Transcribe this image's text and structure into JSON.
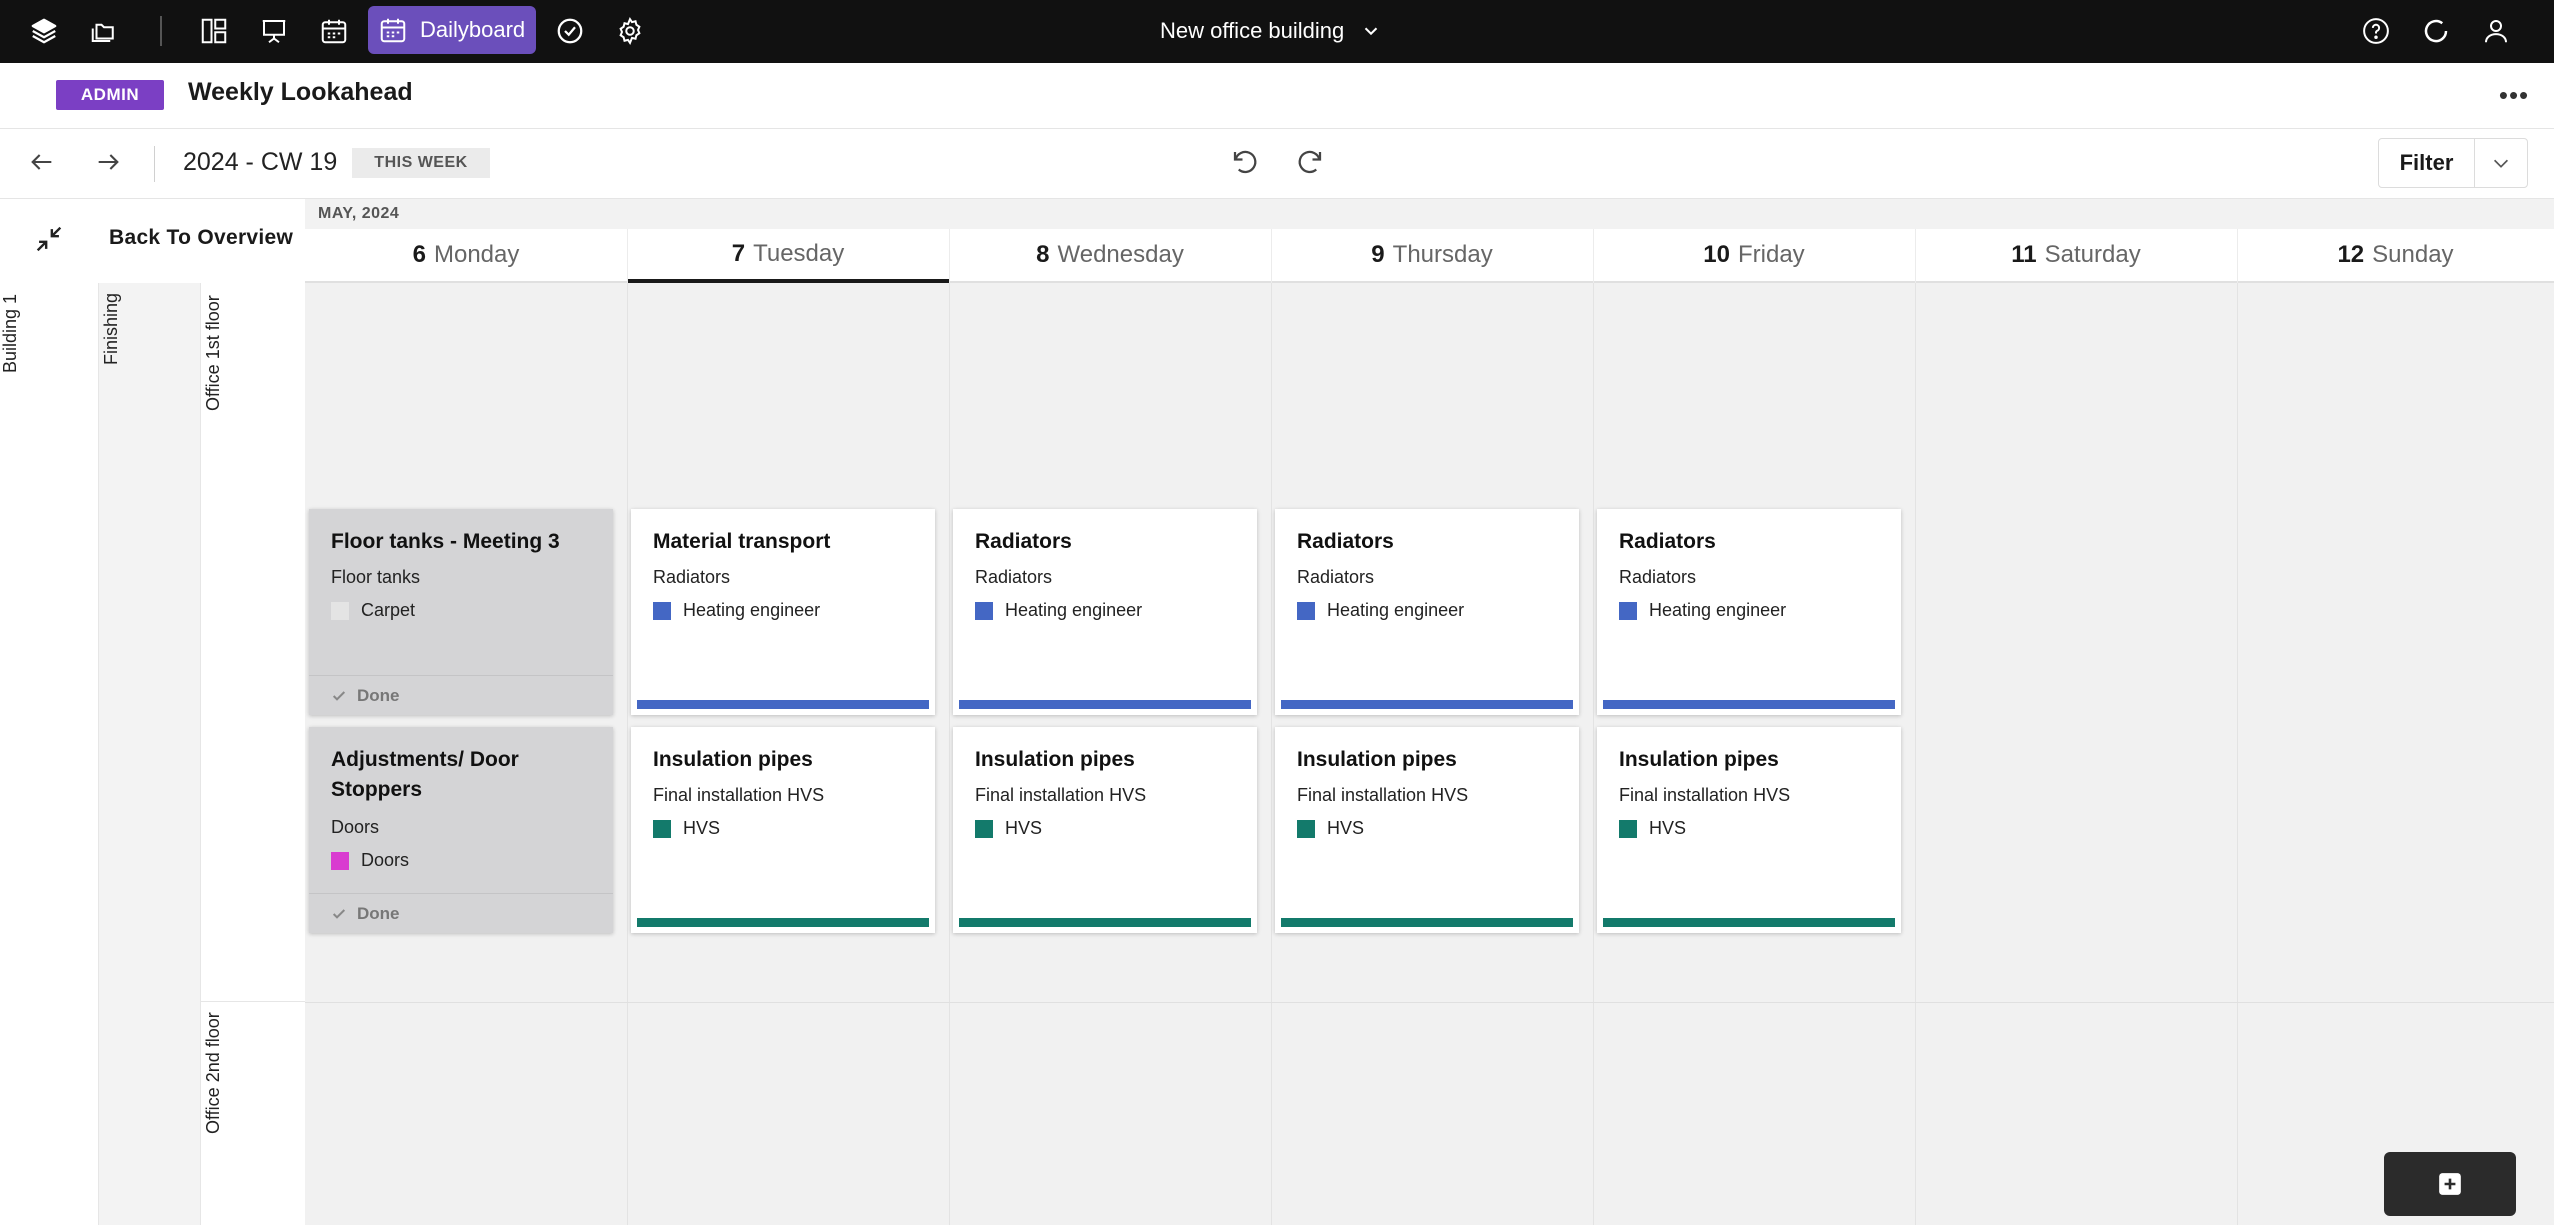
{
  "topbar": {
    "active_label": "Dailyboard",
    "project_name": "New office building",
    "icons": [
      "layers-icon",
      "folders-icon",
      "dashboard-icon",
      "presentation-icon",
      "calendar-icon",
      "calendar-active-icon",
      "check-circle-icon",
      "gear-icon",
      "help-icon",
      "sync-icon",
      "user-icon"
    ]
  },
  "header": {
    "badge": "ADMIN",
    "title": "Weekly Lookahead"
  },
  "toolbar": {
    "week": "2024 - CW 19",
    "this_week": "THIS WEEK",
    "filter": "Filter"
  },
  "board": {
    "back_label": "Back To Overview",
    "month": "MAY, 2024",
    "days": [
      {
        "num": "6",
        "name": "Monday"
      },
      {
        "num": "7",
        "name": "Tuesday"
      },
      {
        "num": "8",
        "name": "Wednesday"
      },
      {
        "num": "9",
        "name": "Thursday"
      },
      {
        "num": "10",
        "name": "Friday"
      },
      {
        "num": "11",
        "name": "Saturday"
      },
      {
        "num": "12",
        "name": "Sunday"
      }
    ],
    "selected_day": "7",
    "lanes": {
      "building": "Building 1",
      "phase": "Finishing",
      "floors": [
        "Office 1st floor",
        "Office 2nd floor"
      ]
    }
  },
  "colors": {
    "heating": "#4467c4",
    "hvs": "#137a6b",
    "doors": "#d93bd0",
    "carpet": "#e4e4e4",
    "accent": "#6b4fbb"
  },
  "cards": {
    "row1": [
      {
        "title": "Floor tanks - Meeting 3",
        "sub": "Floor tanks",
        "tag": "Carpet",
        "status": "Done"
      },
      {
        "title": "Material transport",
        "sub": "Radiators",
        "tag": "Heating engineer"
      },
      {
        "title": "Radiators",
        "sub": "Radiators",
        "tag": "Heating engineer"
      },
      {
        "title": "Radiators",
        "sub": "Radiators",
        "tag": "Heating engineer"
      },
      {
        "title": "Radiators",
        "sub": "Radiators",
        "tag": "Heating engineer"
      }
    ],
    "row2": [
      {
        "title": "Adjustments/ Door Stoppers",
        "sub": "Doors",
        "tag": "Doors",
        "status": "Done"
      },
      {
        "title": "Insulation pipes",
        "sub": "Final installation HVS",
        "tag": "HVS"
      },
      {
        "title": "Insulation pipes",
        "sub": "Final installation HVS",
        "tag": "HVS"
      },
      {
        "title": "Insulation pipes",
        "sub": "Final installation HVS",
        "tag": "HVS"
      },
      {
        "title": "Insulation pipes",
        "sub": "Final installation HVS",
        "tag": "HVS"
      }
    ]
  }
}
